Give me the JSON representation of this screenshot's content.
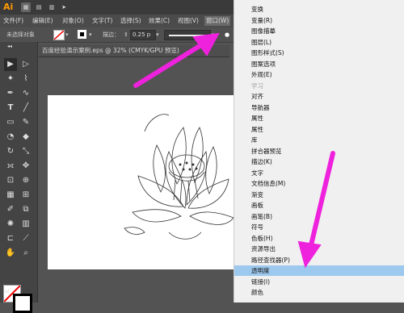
{
  "app": {
    "logo": "Ai"
  },
  "menubar": {
    "items": [
      "文件(F)",
      "编辑(E)",
      "对象(O)",
      "文字(T)",
      "选择(S)",
      "效果(C)",
      "视图(V)",
      "窗口(W)"
    ]
  },
  "controlbar": {
    "no_selection": "未选择对象",
    "stroke_label": "描边：",
    "stroke_value": "0.25 p"
  },
  "document": {
    "tab_title": "百度经验演示案例.eps @ 32% (CMYK/GPU 预览)"
  },
  "window_menu": {
    "items": [
      {
        "label": "变换",
        "disabled": false
      },
      {
        "label": "变量(R)",
        "disabled": false
      },
      {
        "label": "图像描摹",
        "disabled": false
      },
      {
        "label": "图层(L)",
        "disabled": false
      },
      {
        "label": "图形样式(S)",
        "disabled": false
      },
      {
        "label": "图案选项",
        "disabled": false
      },
      {
        "label": "外观(E)",
        "disabled": false
      },
      {
        "label": "学习",
        "disabled": true
      },
      {
        "label": "对齐",
        "disabled": false
      },
      {
        "label": "导航器",
        "disabled": false
      },
      {
        "label": "属性",
        "disabled": false
      },
      {
        "label": "属性",
        "disabled": false
      },
      {
        "label": "库",
        "disabled": false
      },
      {
        "label": "拼合器预览",
        "disabled": false
      },
      {
        "label": "描边(K)",
        "disabled": false
      },
      {
        "label": "文字",
        "disabled": false
      },
      {
        "label": "文档信息(M)",
        "disabled": false
      },
      {
        "label": "渐变",
        "disabled": false
      },
      {
        "label": "画板",
        "disabled": false
      },
      {
        "label": "画笔(B)",
        "disabled": false
      },
      {
        "label": "符号",
        "disabled": false
      },
      {
        "label": "色板(H)",
        "disabled": false
      },
      {
        "label": "资源导出",
        "disabled": false
      },
      {
        "label": "路径查找器(P)",
        "disabled": false
      },
      {
        "label": "透明度",
        "disabled": false
      },
      {
        "label": "链接(I)",
        "disabled": false
      },
      {
        "label": "颜色",
        "disabled": false
      }
    ],
    "highlighted": "透明度"
  },
  "colors": {
    "annotation_arrow": "#ee22dd",
    "menu_highlight": "#9ec9ee",
    "logo": "#ff9a00"
  }
}
